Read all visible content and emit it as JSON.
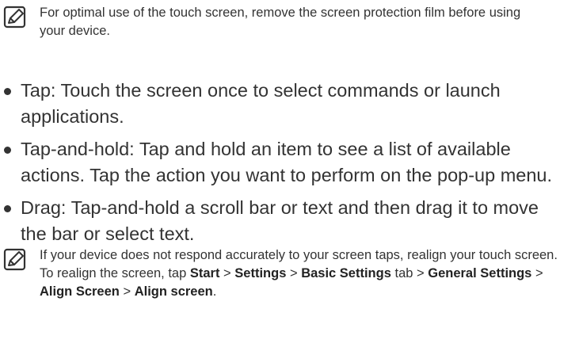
{
  "notes": [
    {
      "icon": "note-pencil-icon",
      "text": "For optimal use of the touch screen, remove the screen protection film before using your device."
    },
    {
      "icon": "note-pencil-icon",
      "parts": [
        "If your device does not respond accurately to your screen taps, realign your touch screen. To realign the screen, tap ",
        "Start",
        " > ",
        "Settings",
        " > ",
        "Basic Settings",
        " tab > ",
        "General Settings",
        " > ",
        "Align Screen",
        " > ",
        "Align screen",
        "."
      ]
    }
  ],
  "bullets": [
    "Tap: Touch the screen once to select commands or launch applications.",
    "Tap-and-hold: Tap and hold an item to see a list of available actions. Tap the action you want to perform on the pop-up menu.",
    "Drag: Tap-and-hold a scroll bar or text and then drag it to move the bar or select text."
  ],
  "colors": {
    "text": "#333333",
    "icon": "#333333"
  }
}
